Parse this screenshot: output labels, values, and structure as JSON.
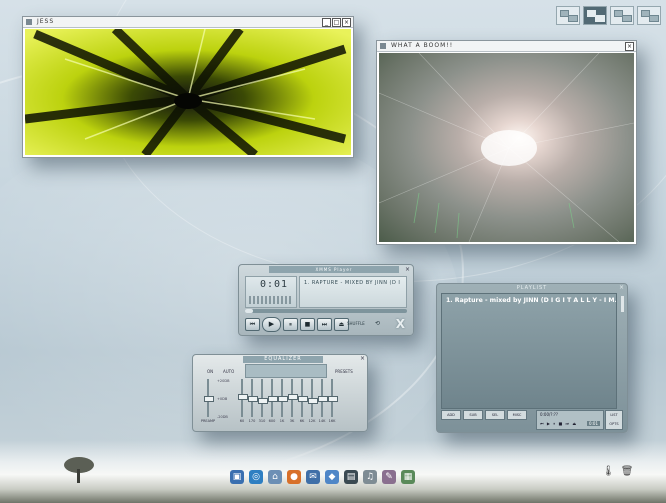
{
  "windows": {
    "jess": {
      "title": "JESS",
      "buttons": [
        "_",
        "□",
        "×"
      ]
    },
    "video": {
      "title": "WHAT A BOOM!!",
      "buttons": [
        "×"
      ]
    }
  },
  "player": {
    "title": "XMMS Player",
    "time": "0:01",
    "marquee": "1. RAPTURE - MIXED BY JINN (D I G I T A L L Y - I M P O R T E D",
    "seek_fraction": 0.05,
    "controls": [
      "⏮",
      "▶",
      "⏸",
      "■",
      "⏭",
      "⏏"
    ],
    "shuffle": "SHUFFLE",
    "repeat": "⟲",
    "logo": "X",
    "close": "×"
  },
  "equalizer": {
    "title": "EQUALIZER",
    "on": "ON",
    "auto": "AUTO",
    "presets": "PRESETS",
    "close": "×",
    "db_labels": [
      "+20DB",
      "+0DB",
      "-20DB"
    ],
    "preamp_label": "PREAMP",
    "preamp_level": 0.5,
    "bands": [
      {
        "label": "60",
        "level": 0.55
      },
      {
        "label": "170",
        "level": 0.5
      },
      {
        "label": "310",
        "level": 0.45
      },
      {
        "label": "600",
        "level": 0.5
      },
      {
        "label": "1K",
        "level": 0.5
      },
      {
        "label": "3K",
        "level": 0.55
      },
      {
        "label": "6K",
        "level": 0.5
      },
      {
        "label": "12K",
        "level": 0.45
      },
      {
        "label": "14K",
        "level": 0.5
      },
      {
        "label": "16K",
        "level": 0.5
      }
    ]
  },
  "playlist": {
    "title": "PLAYLIST",
    "close": "×",
    "items": [
      "1. Rapture - mixed by JINN (D I G I T A L L Y - I M..."
    ],
    "footer_buttons": [
      "ADD",
      "SUB",
      "SEL",
      "MISC"
    ],
    "time": "0:00/?:??",
    "mini_controls": "⏮ ▶ ⏸ ■ ⏭ ⏏",
    "status": "0:01",
    "list_button": "LIST\nOPTS"
  },
  "pager": {
    "count": 4,
    "active": 1
  },
  "taskbar": {
    "icons": [
      {
        "name": "desktop-icon",
        "glyph": "▣",
        "color": "#3a6fb0"
      },
      {
        "name": "browser-icon",
        "glyph": "◎",
        "color": "#2f7fc2"
      },
      {
        "name": "home-icon",
        "glyph": "⌂",
        "color": "#6c8fb5"
      },
      {
        "name": "firefox-icon",
        "glyph": "●",
        "color": "#d8702a"
      },
      {
        "name": "thunderbird-icon",
        "glyph": "✉",
        "color": "#3f6fa8"
      },
      {
        "name": "messenger-icon",
        "glyph": "◆",
        "color": "#4f86c7"
      },
      {
        "name": "terminal-icon",
        "glyph": "▤",
        "color": "#3b4a52"
      },
      {
        "name": "media-icon",
        "glyph": "♫",
        "color": "#7e8c94"
      },
      {
        "name": "config-icon",
        "glyph": "✎",
        "color": "#8a6f8f"
      },
      {
        "name": "archive-icon",
        "glyph": "▦",
        "color": "#5a8a5a"
      }
    ]
  },
  "tray": [
    {
      "name": "thermometer-icon",
      "glyph": "🌡"
    },
    {
      "name": "trash-icon",
      "glyph": "🗑"
    }
  ]
}
